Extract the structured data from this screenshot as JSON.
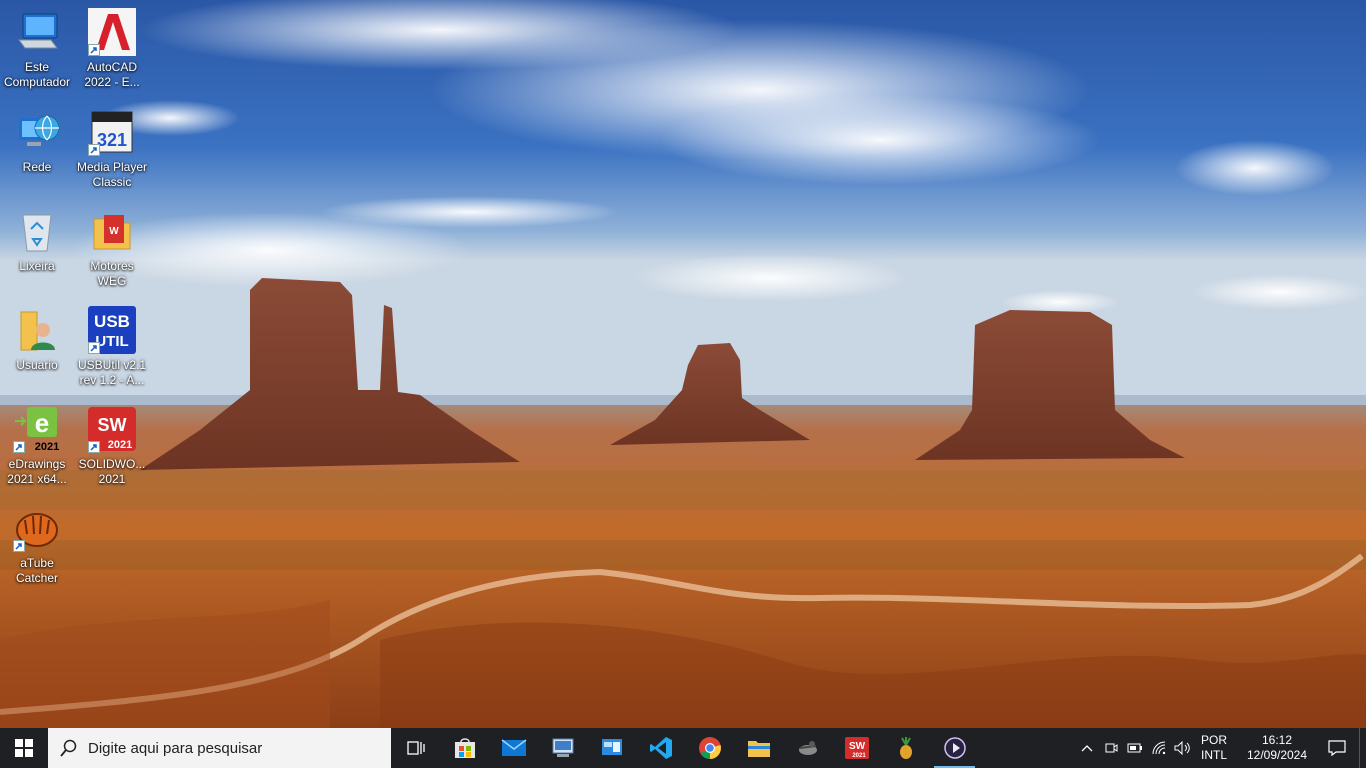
{
  "desktop": {
    "icons": [
      {
        "label": "Este Computador",
        "icon": "computer-icon",
        "shortcut": false
      },
      {
        "label": "AutoCAD 2022 - E...",
        "icon": "autocad-icon",
        "shortcut": true
      },
      {
        "label": "Rede",
        "icon": "network-icon",
        "shortcut": false
      },
      {
        "label": "Media Player Classic",
        "icon": "media-player-classic-icon",
        "shortcut": true
      },
      {
        "label": "Lixeira",
        "icon": "recycle-bin-icon",
        "shortcut": false
      },
      {
        "label": "Motores WEG",
        "icon": "weg-folder-icon",
        "shortcut": false
      },
      {
        "label": "Usuario",
        "icon": "user-folder-icon",
        "shortcut": false
      },
      {
        "label": "USBUtil v2.1 rev 1.2 - A...",
        "icon": "usbutil-icon",
        "shortcut": true
      },
      {
        "label": "eDrawings 2021 x64...",
        "icon": "edrawings-icon",
        "shortcut": true
      },
      {
        "label": "SOLIDWO... 2021",
        "icon": "solidworks-icon",
        "shortcut": true
      },
      {
        "label": "aTube Catcher",
        "icon": "atube-catcher-icon",
        "shortcut": true
      }
    ],
    "icon_badges": {
      "usb_top": "USB",
      "usb_bottom": "UTIL",
      "year": "2021",
      "sw": "SW",
      "mpc": "321",
      "autocad": "A",
      "edraw": "e"
    }
  },
  "taskbar": {
    "search_placeholder": "Digite aqui para pesquisar",
    "apps": [
      {
        "name": "task-view",
        "icon": "task-view-icon"
      },
      {
        "name": "microsoft-store",
        "icon": "store-icon"
      },
      {
        "name": "mail",
        "icon": "mail-icon"
      },
      {
        "name": "remote-desktop",
        "icon": "remote-desktop-icon"
      },
      {
        "name": "control-panel",
        "icon": "control-panel-icon"
      },
      {
        "name": "vscode",
        "icon": "vscode-icon"
      },
      {
        "name": "chrome",
        "icon": "chrome-icon"
      },
      {
        "name": "file-explorer",
        "icon": "folder-icon"
      },
      {
        "name": "cheat-engine",
        "icon": "cheat-engine-icon"
      },
      {
        "name": "solidworks",
        "icon": "solidworks-icon"
      },
      {
        "name": "pineapple-app",
        "icon": "pineapple-icon"
      },
      {
        "name": "media-player",
        "icon": "media-player-icon",
        "running": true
      }
    ],
    "tray": {
      "lang_line1": "POR",
      "lang_line2": "INTL",
      "time": "16:12",
      "date": "12/09/2024"
    }
  },
  "colors": {
    "taskbar_bg": "#1f2023",
    "accent": "#76b9ed",
    "sky_top": "#2a5aa8",
    "desert": "#c0662a"
  }
}
